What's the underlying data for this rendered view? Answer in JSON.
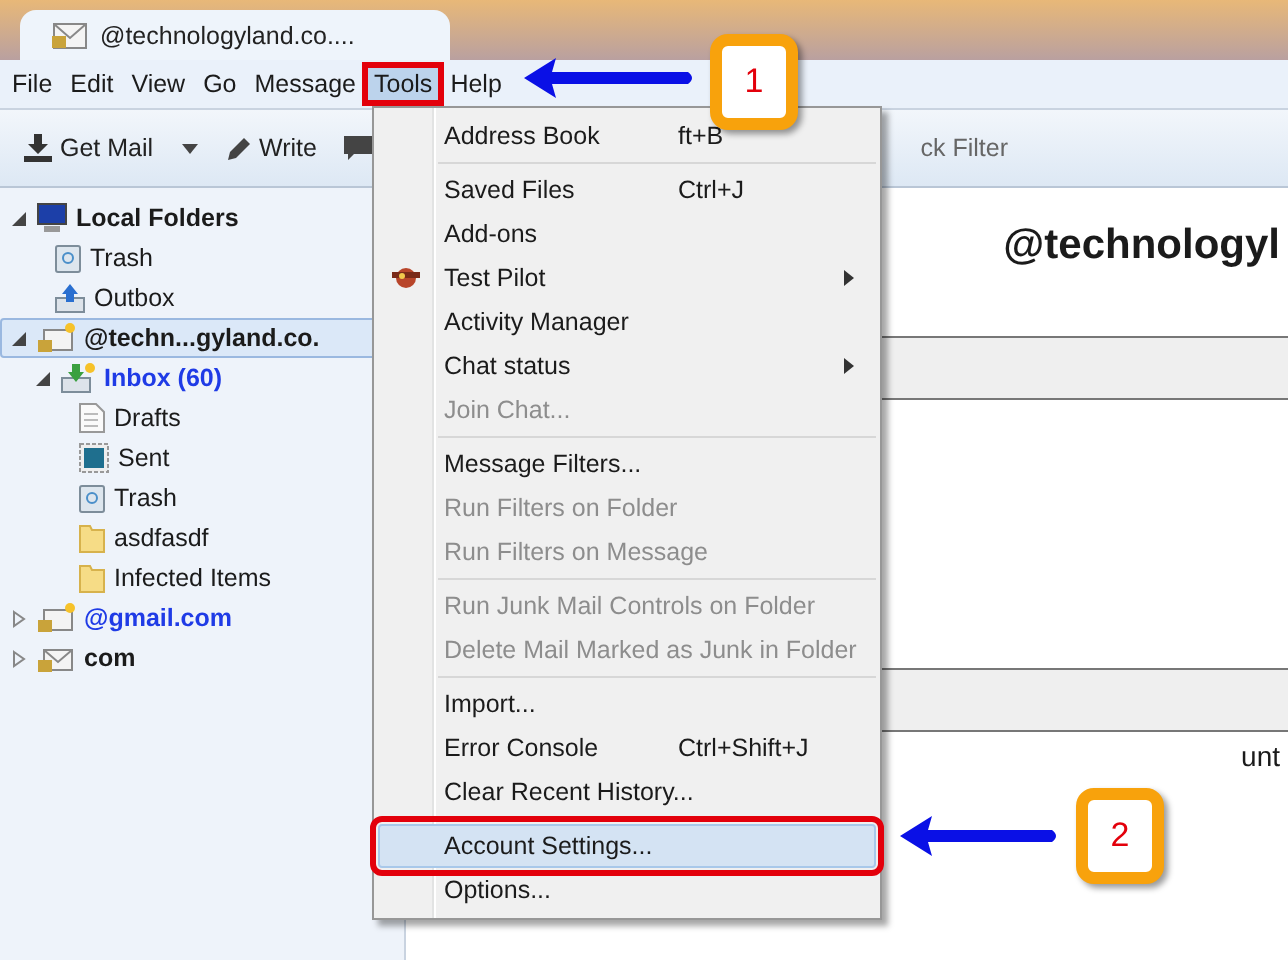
{
  "tab": {
    "title": "@technologyland.co....",
    "selected": true
  },
  "menubar": [
    {
      "label": "File",
      "selected": false
    },
    {
      "label": "Edit",
      "selected": false
    },
    {
      "label": "View",
      "selected": false
    },
    {
      "label": "Go",
      "selected": false
    },
    {
      "label": "Message",
      "selected": false
    },
    {
      "label": "Tools",
      "selected": true
    },
    {
      "label": "Help",
      "selected": false
    }
  ],
  "toolbar": {
    "get_mail": "Get Mail",
    "write": "Write",
    "quick_filter": "ck Filter"
  },
  "folders": [
    {
      "label": "Local Folders",
      "kind": "computer",
      "bold": true,
      "expanded": true,
      "selected": false,
      "children": [
        {
          "label": "Trash",
          "kind": "trash",
          "bold": false,
          "selected": false
        },
        {
          "label": "Outbox",
          "kind": "outbox",
          "bold": false,
          "selected": false
        }
      ]
    },
    {
      "label": "@techn...gyland.co.",
      "kind": "account",
      "bold": true,
      "expanded": true,
      "selected": true,
      "children": [
        {
          "label": "Inbox (60)",
          "kind": "inbox",
          "bold": true,
          "unread": true,
          "expanded": true,
          "selected": false,
          "children": [
            {
              "label": "Drafts",
              "kind": "drafts",
              "bold": false,
              "selected": false
            },
            {
              "label": "Sent",
              "kind": "sent",
              "bold": false,
              "selected": false
            },
            {
              "label": "Trash",
              "kind": "trash",
              "bold": false,
              "selected": false
            },
            {
              "label": "asdfasdf",
              "kind": "folder",
              "bold": false,
              "selected": false
            },
            {
              "label": "Infected Items",
              "kind": "folder",
              "bold": false,
              "selected": false
            }
          ]
        }
      ]
    },
    {
      "label": "@gmail.com",
      "kind": "account",
      "bold": true,
      "unread": true,
      "expanded": false,
      "selected": false
    },
    {
      "label": "com",
      "kind": "mail-account",
      "bold": true,
      "expanded": false,
      "selected": false
    }
  ],
  "content": {
    "title": "@technologyl",
    "link_fragment": "unt"
  },
  "tools_menu": [
    {
      "kind": "item",
      "label": "Address Book",
      "shortcut": "ft+B",
      "disabled": false,
      "selected": false
    },
    {
      "kind": "separator"
    },
    {
      "kind": "item",
      "label": "Saved Files",
      "shortcut": "Ctrl+J",
      "disabled": false,
      "selected": false
    },
    {
      "kind": "item",
      "label": "Add-ons",
      "disabled": false,
      "selected": false
    },
    {
      "kind": "icon-item",
      "label": "Test Pilot",
      "submenu": true,
      "disabled": false,
      "selected": false
    },
    {
      "kind": "item",
      "label": "Activity Manager",
      "disabled": false,
      "selected": false
    },
    {
      "kind": "item",
      "label": "Chat status",
      "submenu": true,
      "disabled": false,
      "selected": false
    },
    {
      "kind": "item",
      "label": "Join Chat...",
      "disabled": true,
      "selected": false
    },
    {
      "kind": "separator"
    },
    {
      "kind": "item",
      "label": "Message Filters...",
      "disabled": false,
      "selected": false
    },
    {
      "kind": "item",
      "label": "Run Filters on Folder",
      "disabled": true,
      "selected": false
    },
    {
      "kind": "item",
      "label": "Run Filters on Message",
      "disabled": true,
      "selected": false
    },
    {
      "kind": "separator"
    },
    {
      "kind": "item",
      "label": "Run Junk Mail Controls on Folder",
      "disabled": true,
      "selected": false
    },
    {
      "kind": "item",
      "label": "Delete Mail Marked as Junk in Folder",
      "disabled": true,
      "selected": false
    },
    {
      "kind": "separator"
    },
    {
      "kind": "item",
      "label": "Import...",
      "disabled": false,
      "selected": false
    },
    {
      "kind": "item",
      "label": "Error Console",
      "shortcut": "Ctrl+Shift+J",
      "disabled": false,
      "selected": false
    },
    {
      "kind": "item",
      "label": "Clear Recent History...",
      "disabled": false,
      "selected": false
    },
    {
      "kind": "separator"
    },
    {
      "kind": "item",
      "label": "Account Settings...",
      "disabled": false,
      "selected": true
    },
    {
      "kind": "item",
      "label": "Options...",
      "disabled": false,
      "selected": false
    }
  ],
  "callouts": [
    {
      "number": "1"
    },
    {
      "number": "2"
    }
  ]
}
